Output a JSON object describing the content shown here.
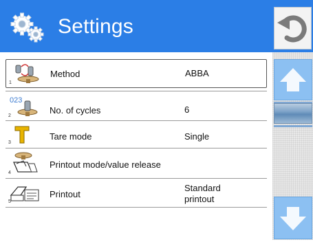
{
  "header": {
    "title": "Settings",
    "icon": "gears-icon",
    "back_icon": "undo-arrow-icon"
  },
  "items": [
    {
      "index": "1",
      "label": "Method",
      "value": "ABBA",
      "icon": "method-weights-icon",
      "selected": true
    },
    {
      "index": "2",
      "label": "No. of cycles",
      "value": "6",
      "icon": "cycles-counter-icon",
      "icon_text": "023"
    },
    {
      "index": "3",
      "label": "Tare mode",
      "value": "Single",
      "icon": "tare-t-icon"
    },
    {
      "index": "4",
      "label": "Printout mode/value release",
      "value": "",
      "icon": "printer-release-icon"
    },
    {
      "index": "5",
      "label": "Printout",
      "value": "Standard printout",
      "value_line1": "Standard",
      "value_line2": "printout",
      "icon": "printout-icon"
    }
  ],
  "scroll": {
    "up_icon": "arrow-up-icon",
    "down_icon": "arrow-down-icon"
  },
  "colors": {
    "header": "#2b7ee6",
    "scroll_buttons": "#8cc0f2"
  }
}
